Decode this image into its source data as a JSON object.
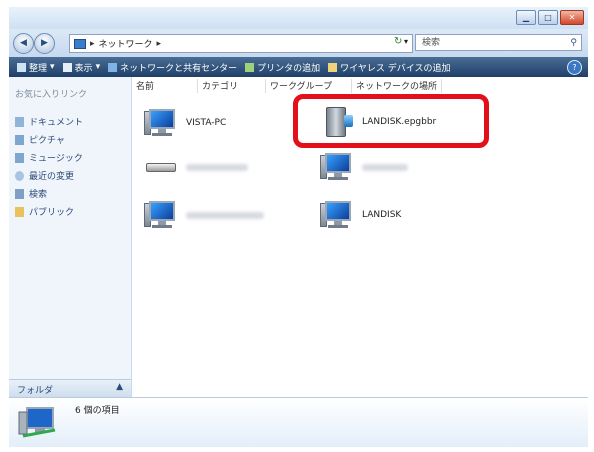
{
  "address": {
    "path": [
      "ネットワーク"
    ],
    "search_placeholder": "検索"
  },
  "toolbar": {
    "items": [
      {
        "label": "整理",
        "has_dropdown": true,
        "icon": "organize-icon"
      },
      {
        "label": "表示",
        "has_dropdown": true,
        "icon": "views-icon"
      },
      {
        "label": "ネットワークと共有センター",
        "icon": "network-center-icon"
      },
      {
        "label": "プリンタの追加",
        "icon": "printer-icon"
      },
      {
        "label": "ワイヤレス デバイスの追加",
        "icon": "wireless-icon"
      }
    ],
    "help": "?"
  },
  "nav": {
    "favorites_header": "お気に入りリンク",
    "favorites": [
      {
        "label": "ドキュメント",
        "icon": "documents-icon"
      },
      {
        "label": "ピクチャ",
        "icon": "pictures-icon"
      },
      {
        "label": "ミュージック",
        "icon": "music-icon"
      },
      {
        "label": "最近の変更",
        "icon": "recent-icon"
      },
      {
        "label": "検索",
        "icon": "search-folder-icon"
      },
      {
        "label": "パブリック",
        "icon": "public-folder-icon"
      }
    ],
    "folders_label": "フォルダ",
    "folders_arrow": "▲"
  },
  "columns": [
    "名前",
    "カテゴリ",
    "ワークグループ",
    "ネットワークの場所"
  ],
  "items": [
    {
      "label": "VISTA-PC",
      "icon": "computer-icon"
    },
    {
      "label": "LANDISK.epgbbr",
      "icon": "nas-device-icon",
      "highlighted": true
    },
    {
      "label": "",
      "icon": "router-icon",
      "blurred": true
    },
    {
      "label": "",
      "icon": "computer-icon",
      "blurred": true
    },
    {
      "label": "",
      "icon": "computer-icon",
      "blurred": true
    },
    {
      "label": "LANDISK",
      "icon": "computer-icon"
    }
  ],
  "details": {
    "count_text": "6 個の項目"
  },
  "colors": {
    "highlight_border": "#e3101c",
    "toolbar_bg": "#1f3f67"
  }
}
